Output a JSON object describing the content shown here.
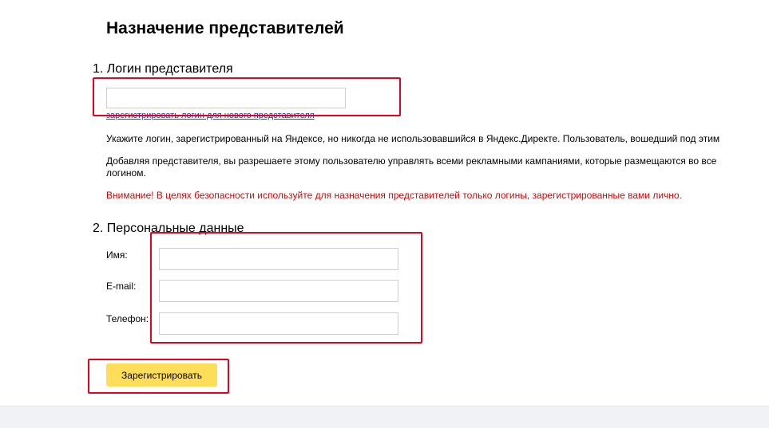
{
  "page": {
    "title": "Назначение представителей"
  },
  "login_section": {
    "heading": "1. Логин представителя",
    "login_input_value": "",
    "register_link": "зарегистрировать логин для нового представителя",
    "info_1": "Укажите логин, зарегистрированный на Яндексе, но никогда не использовавшийся в Яндекс.Директе. Пользователь, вошедший под этим",
    "info_2_line1": "Добавляя представителя, вы разрешаете этому пользователю управлять всеми рекламными кампаниями, которые размещаются во все",
    "info_2_line2": "логином.",
    "warning": "Внимание! В целях безопасности используйте для назначения представителей только логины, зарегистрированные вами лично."
  },
  "personal_section": {
    "heading": "2. Персональные данные",
    "fields": [
      {
        "label": "Имя:",
        "value": ""
      },
      {
        "label": "E-mail:",
        "value": ""
      },
      {
        "label": "Телефон:",
        "value": ""
      }
    ]
  },
  "actions": {
    "submit_label": "Зарегистрировать"
  },
  "colors": {
    "highlight": "#e8001c",
    "button": "#fede59",
    "warning": "#e00000",
    "link": "#1a3dc1"
  }
}
